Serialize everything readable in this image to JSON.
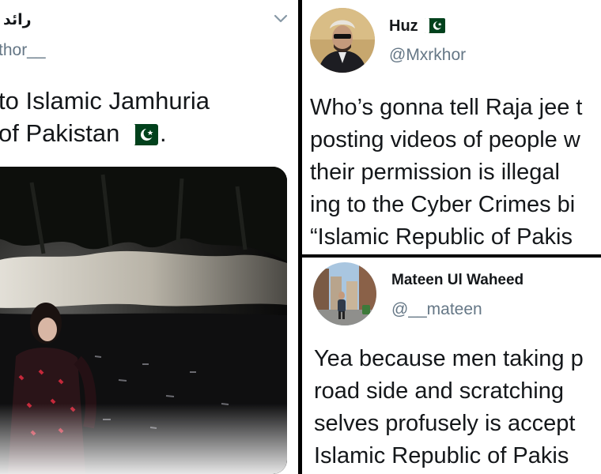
{
  "tweet_left": {
    "author_name": "رائد",
    "handle": "thor__",
    "lines": [
      "to Islamic Jamhuria",
      "of Pakistan",
      "."
    ],
    "flag_icon": "pakistan-flag-icon",
    "menu_icon": "chevron-down-icon"
  },
  "tweet_top_right": {
    "author_name": "Huz",
    "flag_icon": "pakistan-flag-icon",
    "handle": "@Mxrkhor",
    "lines": [
      "Who’s gonna tell Raja jee t",
      "posting videos of people w",
      "their permission is illegal",
      "ing to the Cyber Crimes bi",
      "“Islamic Republic of Pakis"
    ]
  },
  "tweet_bottom_right": {
    "author_name": "Mateen Ul Waheed",
    "handle": "@__mateen",
    "lines": [
      "Yea because men taking p",
      "road side and scratching",
      "selves profusely is accept",
      "Islamic Republic of Pakis"
    ]
  },
  "colors": {
    "text": "#14171a",
    "secondary_text": "#657786",
    "divider": "#000000",
    "flag_green": "#01411c"
  }
}
